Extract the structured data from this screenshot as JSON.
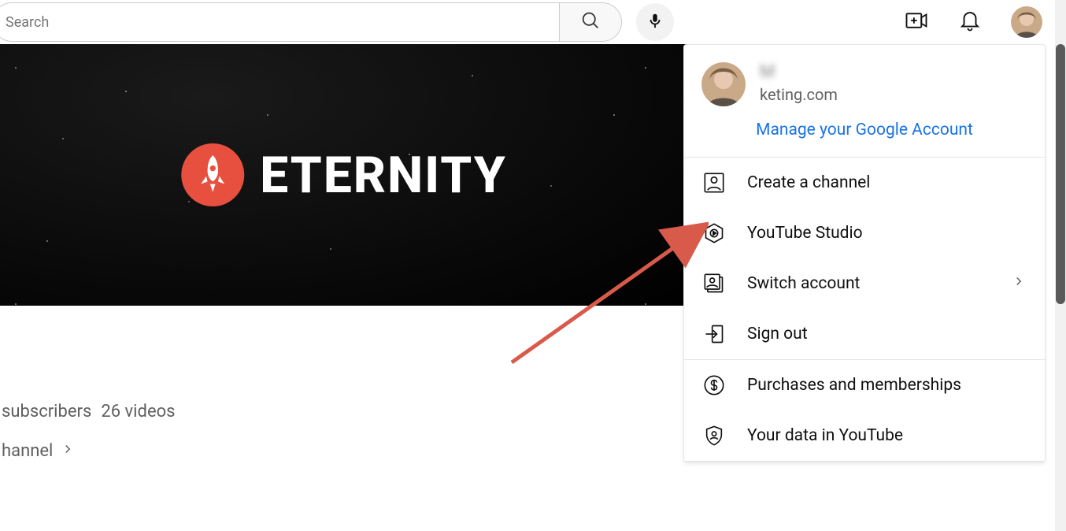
{
  "topbar": {
    "search_placeholder": "Search",
    "mic_label": "Search with your voice",
    "create_label": "Create",
    "notifications_label": "Notifications"
  },
  "banner": {
    "brand_text": "ETERNITY"
  },
  "channel": {
    "subscribers_fragment": "subscribers",
    "videos_count_text": "26 videos",
    "more_about_text": "hannel"
  },
  "account_menu": {
    "user_name": "M",
    "user_email_partial": "keting.com",
    "manage_link": "Manage your Google Account",
    "items_group1": [
      {
        "icon": "person",
        "label": "Create a channel",
        "has_chevron": false
      },
      {
        "icon": "studio",
        "label": "YouTube Studio",
        "has_chevron": false
      },
      {
        "icon": "switch",
        "label": "Switch account",
        "has_chevron": true
      },
      {
        "icon": "signout",
        "label": "Sign out",
        "has_chevron": false
      }
    ],
    "items_group2": [
      {
        "icon": "dollar",
        "label": "Purchases and memberships",
        "has_chevron": false
      },
      {
        "icon": "shield",
        "label": "Your data in YouTube",
        "has_chevron": false
      }
    ]
  }
}
